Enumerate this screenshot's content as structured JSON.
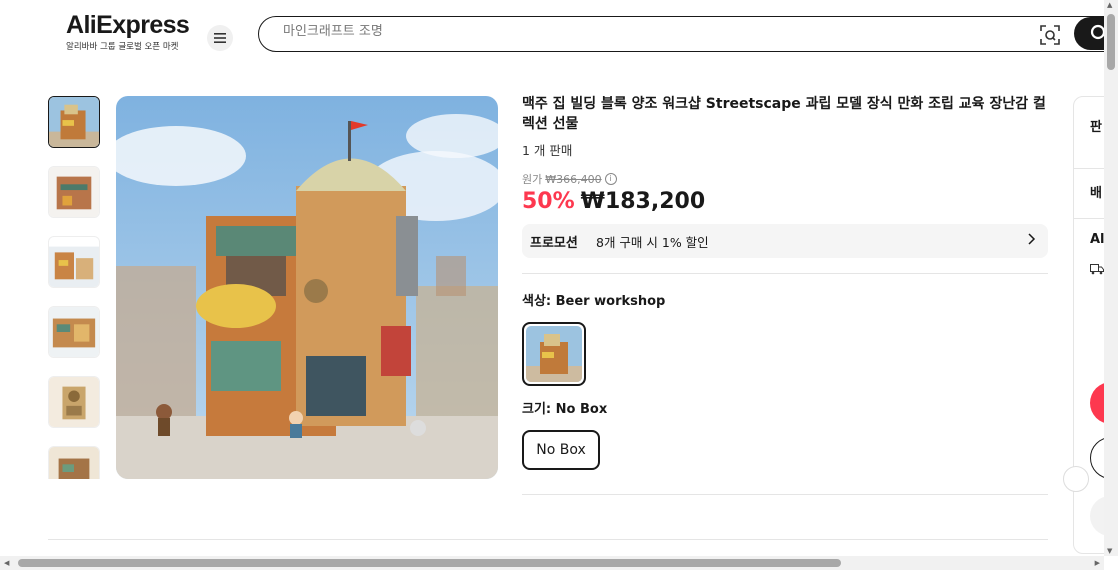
{
  "header": {
    "logo_text": "AliExpress",
    "logo_sub": "알리바바 그룹 글로벌 오픈 마켓",
    "search_placeholder": "마인크래프트 조명"
  },
  "product": {
    "title": "맥주 집 빌딩 블록 양조 워크샵 Streetscape 과립 모델 장식 만화 조립 교육 장난감 컬렉션 선물",
    "sold": "1 개 판매",
    "original_label": "원가",
    "original_price": "₩366,400",
    "discount": "50%",
    "price": "₩183,200",
    "promo_tag": "프로모션",
    "promo_text": "8개 구매 시 1% 할인",
    "color_label": "색상: Beer workshop",
    "size_label": "크기: No Box",
    "size_option": "No Box"
  },
  "right_panel": {
    "label_1": "판",
    "label_2": "배",
    "label_3": "Al"
  },
  "colors": {
    "brand_red": "#fd384f",
    "dark": "#191919"
  }
}
